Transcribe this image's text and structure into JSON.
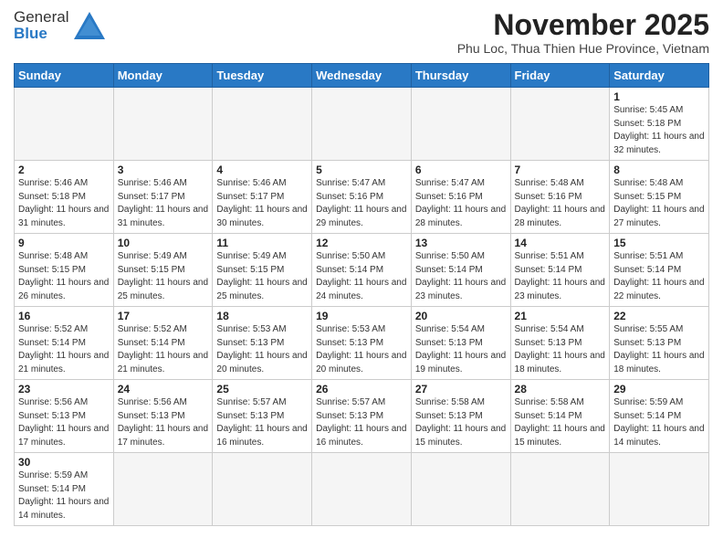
{
  "header": {
    "logo_line1": "General",
    "logo_line2": "Blue",
    "month": "November 2025",
    "location": "Phu Loc, Thua Thien Hue Province, Vietnam"
  },
  "weekdays": [
    "Sunday",
    "Monday",
    "Tuesday",
    "Wednesday",
    "Thursday",
    "Friday",
    "Saturday"
  ],
  "weeks": [
    [
      {
        "day": null
      },
      {
        "day": null
      },
      {
        "day": null
      },
      {
        "day": null
      },
      {
        "day": null
      },
      {
        "day": null
      },
      {
        "day": "1",
        "sunrise": "5:45 AM",
        "sunset": "5:18 PM",
        "daylight": "11 hours and 32 minutes."
      }
    ],
    [
      {
        "day": "2",
        "sunrise": "5:46 AM",
        "sunset": "5:18 PM",
        "daylight": "11 hours and 31 minutes."
      },
      {
        "day": "3",
        "sunrise": "5:46 AM",
        "sunset": "5:17 PM",
        "daylight": "11 hours and 31 minutes."
      },
      {
        "day": "4",
        "sunrise": "5:46 AM",
        "sunset": "5:17 PM",
        "daylight": "11 hours and 30 minutes."
      },
      {
        "day": "5",
        "sunrise": "5:47 AM",
        "sunset": "5:16 PM",
        "daylight": "11 hours and 29 minutes."
      },
      {
        "day": "6",
        "sunrise": "5:47 AM",
        "sunset": "5:16 PM",
        "daylight": "11 hours and 28 minutes."
      },
      {
        "day": "7",
        "sunrise": "5:48 AM",
        "sunset": "5:16 PM",
        "daylight": "11 hours and 28 minutes."
      },
      {
        "day": "8",
        "sunrise": "5:48 AM",
        "sunset": "5:15 PM",
        "daylight": "11 hours and 27 minutes."
      }
    ],
    [
      {
        "day": "9",
        "sunrise": "5:48 AM",
        "sunset": "5:15 PM",
        "daylight": "11 hours and 26 minutes."
      },
      {
        "day": "10",
        "sunrise": "5:49 AM",
        "sunset": "5:15 PM",
        "daylight": "11 hours and 25 minutes."
      },
      {
        "day": "11",
        "sunrise": "5:49 AM",
        "sunset": "5:15 PM",
        "daylight": "11 hours and 25 minutes."
      },
      {
        "day": "12",
        "sunrise": "5:50 AM",
        "sunset": "5:14 PM",
        "daylight": "11 hours and 24 minutes."
      },
      {
        "day": "13",
        "sunrise": "5:50 AM",
        "sunset": "5:14 PM",
        "daylight": "11 hours and 23 minutes."
      },
      {
        "day": "14",
        "sunrise": "5:51 AM",
        "sunset": "5:14 PM",
        "daylight": "11 hours and 23 minutes."
      },
      {
        "day": "15",
        "sunrise": "5:51 AM",
        "sunset": "5:14 PM",
        "daylight": "11 hours and 22 minutes."
      }
    ],
    [
      {
        "day": "16",
        "sunrise": "5:52 AM",
        "sunset": "5:14 PM",
        "daylight": "11 hours and 21 minutes."
      },
      {
        "day": "17",
        "sunrise": "5:52 AM",
        "sunset": "5:14 PM",
        "daylight": "11 hours and 21 minutes."
      },
      {
        "day": "18",
        "sunrise": "5:53 AM",
        "sunset": "5:13 PM",
        "daylight": "11 hours and 20 minutes."
      },
      {
        "day": "19",
        "sunrise": "5:53 AM",
        "sunset": "5:13 PM",
        "daylight": "11 hours and 20 minutes."
      },
      {
        "day": "20",
        "sunrise": "5:54 AM",
        "sunset": "5:13 PM",
        "daylight": "11 hours and 19 minutes."
      },
      {
        "day": "21",
        "sunrise": "5:54 AM",
        "sunset": "5:13 PM",
        "daylight": "11 hours and 18 minutes."
      },
      {
        "day": "22",
        "sunrise": "5:55 AM",
        "sunset": "5:13 PM",
        "daylight": "11 hours and 18 minutes."
      }
    ],
    [
      {
        "day": "23",
        "sunrise": "5:56 AM",
        "sunset": "5:13 PM",
        "daylight": "11 hours and 17 minutes."
      },
      {
        "day": "24",
        "sunrise": "5:56 AM",
        "sunset": "5:13 PM",
        "daylight": "11 hours and 17 minutes."
      },
      {
        "day": "25",
        "sunrise": "5:57 AM",
        "sunset": "5:13 PM",
        "daylight": "11 hours and 16 minutes."
      },
      {
        "day": "26",
        "sunrise": "5:57 AM",
        "sunset": "5:13 PM",
        "daylight": "11 hours and 16 minutes."
      },
      {
        "day": "27",
        "sunrise": "5:58 AM",
        "sunset": "5:13 PM",
        "daylight": "11 hours and 15 minutes."
      },
      {
        "day": "28",
        "sunrise": "5:58 AM",
        "sunset": "5:14 PM",
        "daylight": "11 hours and 15 minutes."
      },
      {
        "day": "29",
        "sunrise": "5:59 AM",
        "sunset": "5:14 PM",
        "daylight": "11 hours and 14 minutes."
      }
    ],
    [
      {
        "day": "30",
        "sunrise": "5:59 AM",
        "sunset": "5:14 PM",
        "daylight": "11 hours and 14 minutes."
      },
      {
        "day": null
      },
      {
        "day": null
      },
      {
        "day": null
      },
      {
        "day": null
      },
      {
        "day": null
      },
      {
        "day": null
      }
    ]
  ]
}
